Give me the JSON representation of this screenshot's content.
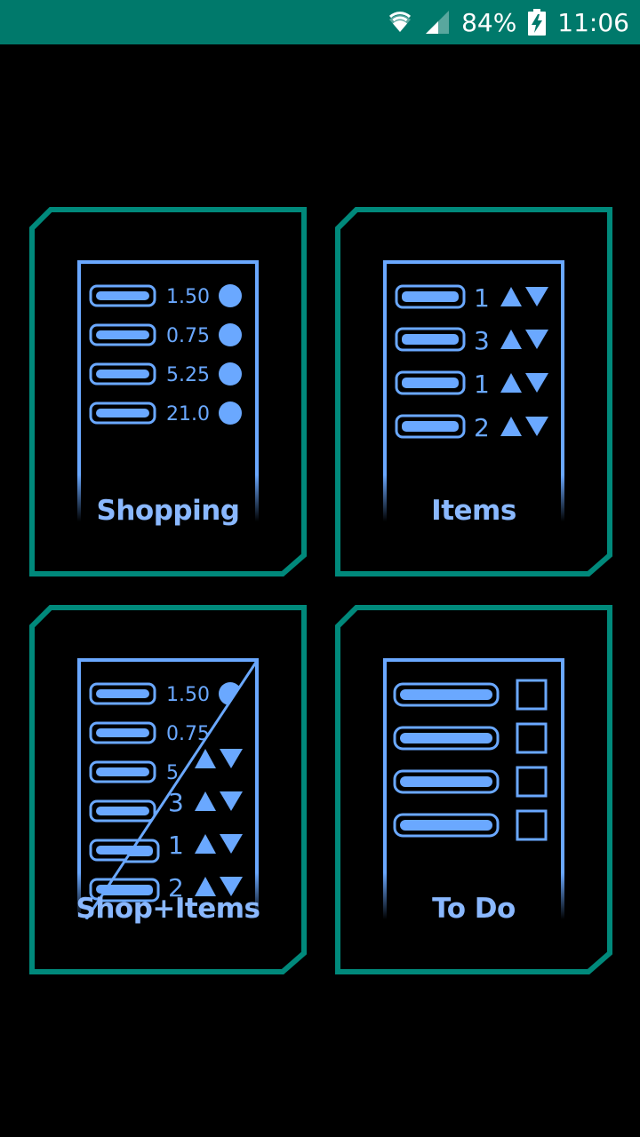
{
  "status_bar": {
    "battery_percent": "84%",
    "time": "11:06",
    "icons": [
      "wifi-icon",
      "signal-icon",
      "battery-charging-icon"
    ]
  },
  "tiles": [
    {
      "label": "Shopping",
      "prices": [
        "1.50",
        "0.75",
        "5.25",
        "21.0"
      ]
    },
    {
      "label": "Items",
      "quantities": [
        "1",
        "3",
        "1",
        "2"
      ]
    },
    {
      "label": "Shop+Items",
      "prices": [
        "1.50",
        "0.75",
        "5"
      ],
      "quantities": [
        "3",
        "1",
        "2"
      ]
    },
    {
      "label": "To Do",
      "task_count": 4
    }
  ],
  "colors": {
    "status_bar": "#00796b",
    "tile_border": "#00897b",
    "accent": "#8ab8ff"
  }
}
